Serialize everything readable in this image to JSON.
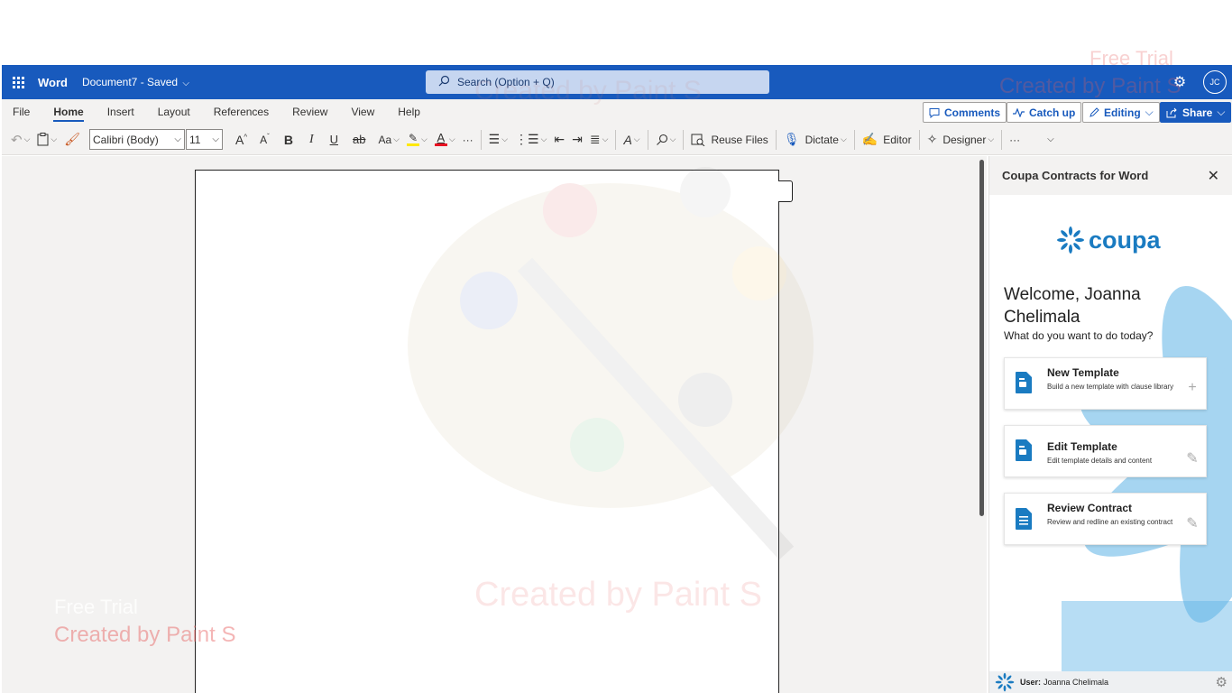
{
  "titlebar": {
    "app_name": "Word",
    "doc_name": "Document7",
    "doc_status": "- Saved",
    "search_placeholder": "Search (Option + Q)",
    "avatar_initials": "JC"
  },
  "ribbon": {
    "tabs": [
      "File",
      "Home",
      "Insert",
      "Layout",
      "References",
      "Review",
      "View",
      "Help"
    ],
    "active_tab": "Home",
    "comments_label": "Comments",
    "catchup_label": "Catch up",
    "editing_label": "Editing",
    "share_label": "Share"
  },
  "toolbar": {
    "font_name": "Calibri (Body)",
    "font_size": "11",
    "bold": "B",
    "italic": "I",
    "underline": "U",
    "strike": "ab",
    "change_case": "Aa",
    "reuse_files": "Reuse Files",
    "dictate": "Dictate",
    "editor": "Editor",
    "designer": "Designer",
    "more": "···"
  },
  "taskpane": {
    "title": "Coupa Contracts for Word",
    "logo_text": "coupa",
    "welcome": "Welcome, Joanna Chelimala",
    "question": "What do you want to do today?",
    "cards": [
      {
        "title": "New Template",
        "desc": "Build a new template with clause library",
        "action": "+"
      },
      {
        "title": "Edit Template",
        "desc": "Edit template details and content",
        "action": "pencil"
      },
      {
        "title": "Review Contract",
        "desc": "Review and redline an existing contract",
        "action": "pencil"
      }
    ],
    "footer_label": "User:",
    "footer_user": "Joanna Chelimala"
  },
  "watermarks": {
    "free_trial": "Free Trial",
    "created_by": "Created by Paint S"
  },
  "colors": {
    "word_blue": "#185abd",
    "coupa_blue": "#1a7bc1",
    "pane_accent": "#5fb3e6"
  },
  "icons": [
    "waffle-icon",
    "search-icon",
    "settings-icon",
    "undo-icon",
    "paste-icon",
    "format-painter-icon",
    "highlighter-icon",
    "font-color-icon",
    "bullets-icon",
    "numbering-icon",
    "decrease-indent-icon",
    "increase-indent-icon",
    "align-icon",
    "styles-icon",
    "find-icon",
    "reuse-files-icon",
    "microphone-icon",
    "editor-icon",
    "designer-icon",
    "close-icon",
    "document-icon",
    "plus-icon",
    "pencil-icon",
    "gear-icon"
  ]
}
